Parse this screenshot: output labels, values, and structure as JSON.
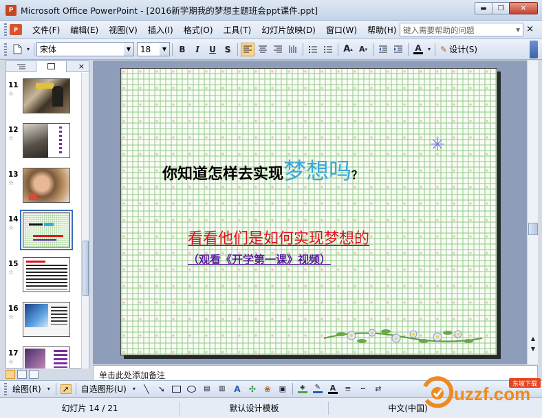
{
  "window": {
    "title": "Microsoft Office PowerPoint - [2016新学期我的梦想主题班会ppt课件.ppt]",
    "app_badge": "P",
    "minimize": "▬",
    "restore": "❐",
    "close": "✕"
  },
  "menu": {
    "items": [
      "文件(F)",
      "编辑(E)",
      "视图(V)",
      "插入(I)",
      "格式(O)",
      "工具(T)",
      "幻灯片放映(D)",
      "窗口(W)",
      "帮助(H)"
    ],
    "help_placeholder": "键入需要帮助的问题",
    "doc_close": "×"
  },
  "format_toolbar": {
    "font_name": "宋体",
    "font_size": "18",
    "bold": "B",
    "italic": "I",
    "underline": "U",
    "shadow": "S",
    "design_label": "设计(S)"
  },
  "slide_pane": {
    "close": "×",
    "slides": [
      {
        "num": "11"
      },
      {
        "num": "12"
      },
      {
        "num": "13"
      },
      {
        "num": "14",
        "selected": true
      },
      {
        "num": "15"
      },
      {
        "num": "16"
      },
      {
        "num": "17"
      }
    ]
  },
  "slide": {
    "question_prefix": "你知道怎样去实现",
    "question_big": "梦想吗",
    "question_mark": "？",
    "red_line": "看看他们是如何实现梦想的",
    "purple_line": "（观看《开学第一课》视频）"
  },
  "notes": {
    "text": "单击此处添加备注"
  },
  "drawing_toolbar": {
    "draw_label": "绘图(R)",
    "autoshapes_label": "自选图形(U)"
  },
  "status": {
    "slide_counter": "幻灯片 14 / 21",
    "template": "默认设计模板",
    "language": "中文(中国)"
  },
  "logo": {
    "text": "uzzf.com",
    "tag": "东坡下载"
  },
  "colors": {
    "accent_blue": "#3aa8df",
    "red_text": "#e0111d",
    "purple_text": "#5a1e9e",
    "logo_orange": "#f08a1e"
  }
}
